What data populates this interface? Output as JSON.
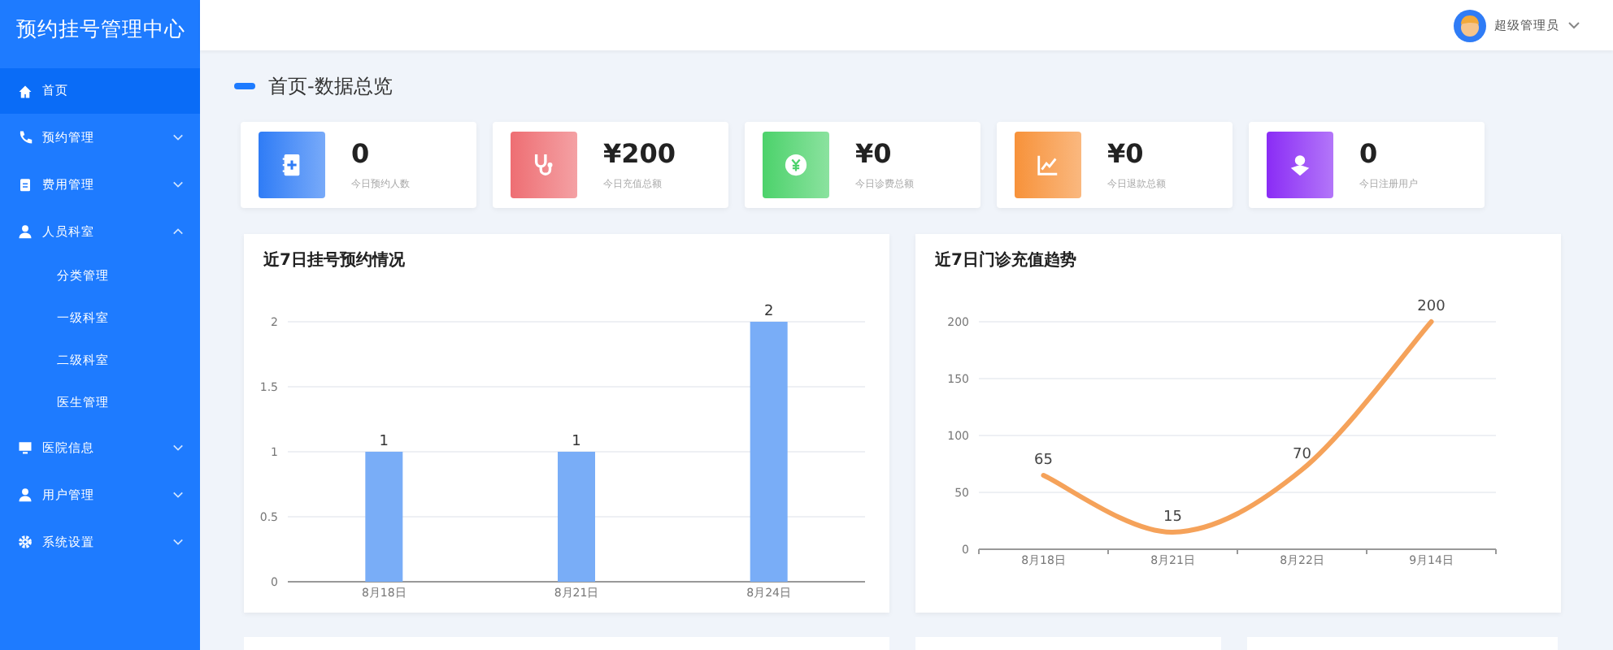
{
  "app_title": "预约挂号管理中心",
  "sidebar": {
    "items": [
      {
        "label": "首页",
        "selected": true,
        "expandable": false
      },
      {
        "label": "预约管理",
        "selected": false,
        "expandable": true,
        "expanded": false
      },
      {
        "label": "费用管理",
        "selected": false,
        "expandable": true,
        "expanded": false
      },
      {
        "label": "人员科室",
        "selected": false,
        "expandable": true,
        "expanded": true,
        "children": [
          {
            "label": "分类管理"
          },
          {
            "label": "一级科室"
          },
          {
            "label": "二级科室"
          },
          {
            "label": "医生管理"
          }
        ]
      },
      {
        "label": "医院信息",
        "selected": false,
        "expandable": true,
        "expanded": false
      },
      {
        "label": "用户管理",
        "selected": false,
        "expandable": true,
        "expanded": false
      },
      {
        "label": "系统设置",
        "selected": false,
        "expandable": true,
        "expanded": false
      }
    ]
  },
  "header": {
    "user": "超级管理员"
  },
  "page_title": "首页-数据总览",
  "stats": [
    {
      "value": "0",
      "label": "今日预约人数",
      "color": "#2f7cf6"
    },
    {
      "value": "¥200",
      "label": "今日充值总额",
      "color": "#ee6e73"
    },
    {
      "value": "¥0",
      "label": "今日诊费总额",
      "color": "#4cd26b"
    },
    {
      "value": "¥0",
      "label": "今日退款总额",
      "color": "#f7923a"
    },
    {
      "value": "0",
      "label": "今日注册用户",
      "color": "#8a2cf5"
    }
  ],
  "charts": [
    {
      "title": "近7日挂号预约情况",
      "chart_data": {
        "type": "bar",
        "categories": [
          "8月18日",
          "8月21日",
          "8月24日"
        ],
        "values": [
          1,
          1,
          2
        ],
        "grid": true,
        "ylim": [
          0,
          2
        ],
        "yticks": [
          0,
          {
            "value": 0.5,
            "label": "0.5"
          },
          1,
          {
            "value": 1.5,
            "label": "1.5"
          },
          2
        ],
        "data_labels": true
      }
    },
    {
      "title": "近7日门诊充值趋势",
      "chart_data": {
        "type": "line",
        "categories": [
          "8月18日",
          "8月21日",
          "8月22日",
          "9月14日"
        ],
        "values": [
          65,
          15,
          70,
          200
        ],
        "grid": true,
        "ylim": [
          0,
          200
        ],
        "yticks": [
          0,
          50,
          100,
          150,
          200
        ],
        "data_labels": true
      }
    }
  ]
}
